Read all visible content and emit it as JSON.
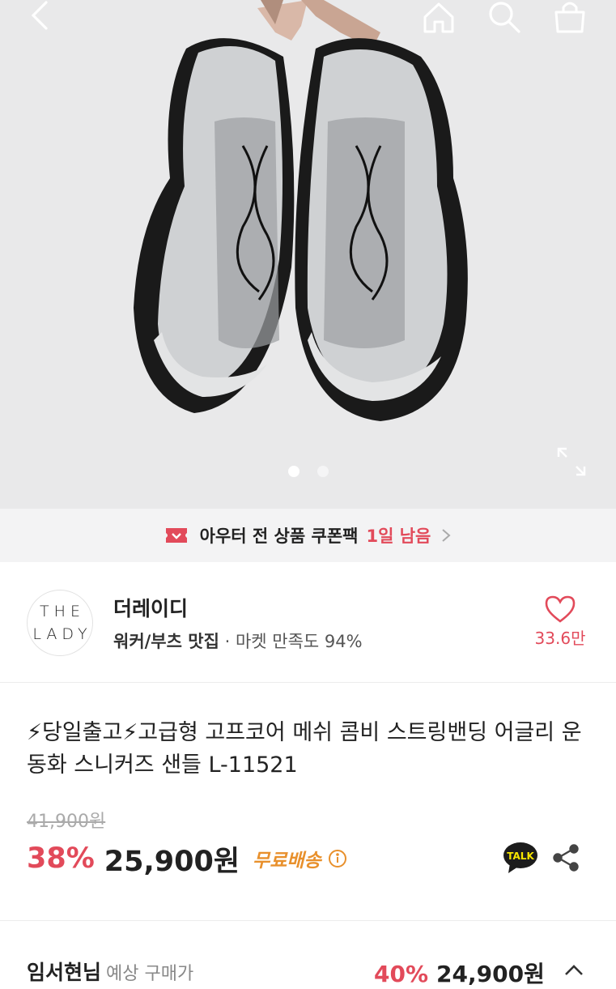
{
  "topbar": {
    "back": "back-arrow-icon",
    "home": "home-icon",
    "search": "search-icon",
    "cart": "shopping-bag-icon"
  },
  "gallery": {
    "image": "black and grey mesh sandal sneakers held by hand",
    "total_images": 2,
    "active_index": 0
  },
  "coupon_banner": {
    "text": "아우터 전 상품 쿠폰팩",
    "accent": "1일 남음"
  },
  "store": {
    "logo_line1": "THE",
    "logo_line2": "LADY",
    "name": "더레이디",
    "tag": "워커/부츠 맛집",
    "satisfaction": "· 마켓 만족도 94%",
    "likes": "33.6만"
  },
  "product": {
    "title": "⚡당일출고⚡고급형 고프코어 메쉬 콤비 스트링밴딩 어글리 운동화 스니커즈 샌들 L-11521",
    "original_price": "41,900원",
    "discount": "38%",
    "price": "25,900원",
    "shipping": "무료배송",
    "talk_label": "TALK"
  },
  "bottom": {
    "left_bold": "임서현님",
    "left_muted": "예상 구매가",
    "discount": "40%",
    "price": "24,900원"
  },
  "colors": {
    "accent_red": "#e24a5a",
    "shipping_orange": "#e8902c",
    "kakao_yellow": "#f7e600"
  }
}
